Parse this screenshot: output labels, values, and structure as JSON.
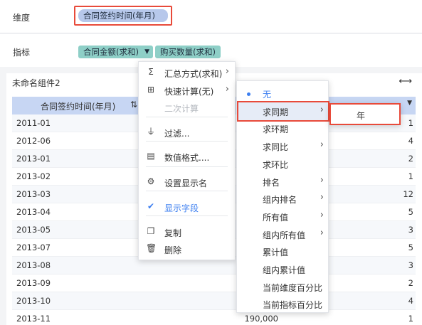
{
  "dimension": {
    "label": "维度",
    "pill": "合同签约时间(年月)"
  },
  "metric": {
    "label": "指标",
    "pill1": "合同金额(求和)",
    "pill2": "购买数量(求和)"
  },
  "widget": {
    "title": "未命名组件2",
    "header": {
      "dim": "合同签约时间(年月)"
    },
    "rows": [
      {
        "d": "2011-01",
        "v": "1"
      },
      {
        "d": "2012-06",
        "v": "4"
      },
      {
        "d": "2013-01",
        "v": "2"
      },
      {
        "d": "2013-02",
        "v": "1"
      },
      {
        "d": "2013-03",
        "v": "12"
      },
      {
        "d": "2013-04",
        "v": "5"
      },
      {
        "d": "2013-05",
        "v": "3"
      },
      {
        "d": "2013-07",
        "v": "5"
      },
      {
        "d": "2013-08",
        "v": "3"
      },
      {
        "d": "2013-09",
        "v": "2"
      },
      {
        "d": "2013-10",
        "v": "4"
      },
      {
        "d": "2013-11",
        "v": "1",
        "amount": "190,000"
      }
    ]
  },
  "menu1": [
    {
      "label": "汇总方式(求和)",
      "icon": "sigma-icon",
      "arrow": true
    },
    {
      "label": "快速计算(无)",
      "icon": "calc-icon",
      "arrow": true
    },
    {
      "label": "二次计算",
      "disabled": true
    },
    {
      "label": "过滤...",
      "icon": "filter-icon"
    },
    {
      "label": "数值格式....",
      "icon": "number-format-icon"
    },
    {
      "label": "设置显示名",
      "icon": "gear-icon"
    },
    {
      "label": "显示字段",
      "icon": "check-icon",
      "active": true
    },
    {
      "label": "复制",
      "icon": "copy-icon"
    },
    {
      "label": "删除",
      "icon": "trash-icon"
    }
  ],
  "menu2": [
    {
      "label": "无",
      "selected": true
    },
    {
      "label": "求同期",
      "arrow": true
    },
    {
      "label": "求环期"
    },
    {
      "label": "求同比",
      "arrow": true
    },
    {
      "label": "求环比"
    },
    {
      "label": "排名",
      "arrow": true
    },
    {
      "label": "组内排名",
      "arrow": true
    },
    {
      "label": "所有值",
      "arrow": true
    },
    {
      "label": "组内所有值",
      "arrow": true
    },
    {
      "label": "累计值"
    },
    {
      "label": "组内累计值"
    },
    {
      "label": "当前维度百分比"
    },
    {
      "label": "当前指标百分比"
    }
  ],
  "menu3": {
    "label": "年"
  }
}
